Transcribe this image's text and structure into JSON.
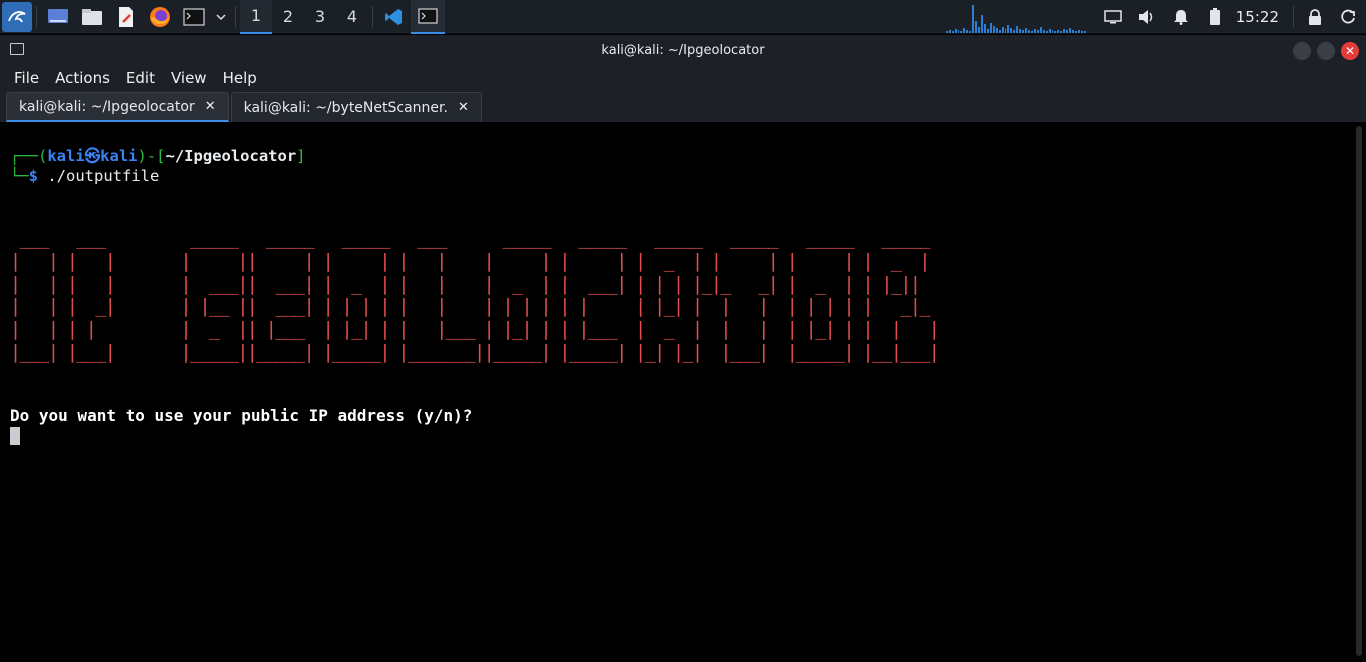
{
  "panel": {
    "workspaces": [
      "1",
      "2",
      "3",
      "4"
    ],
    "active_workspace": "1",
    "clock": "15:22",
    "launchers": [
      "kali-menu-icon",
      "desktop-icon",
      "files-icon",
      "text-editor-icon",
      "firefox-icon",
      "terminal-icon"
    ],
    "tray_icons": [
      "display-icon",
      "volume-icon",
      "bell-icon",
      "battery-icon",
      "lock-icon",
      "power-icon"
    ]
  },
  "window": {
    "title": "kali@kali: ~/Ipgeolocator"
  },
  "menu": {
    "items": [
      "File",
      "Actions",
      "Edit",
      "View",
      "Help"
    ]
  },
  "tabs": [
    {
      "label": "kali@kali: ~/Ipgeolocator",
      "active": true
    },
    {
      "label": "kali@kali: ~/byteNetScanner.",
      "active": false
    }
  ],
  "terminal": {
    "prompt_user": "kali",
    "prompt_at": "㉿",
    "prompt_host": "kali",
    "prompt_dir": "~/Ipgeolocator",
    "command": "./outputfile",
    "question": "Do you want to use your public IP address (y/n)?",
    "ascii_art": [
      " ___   ___         _____   _____   _____   ___      _____   _____   _____   _____   _____   _____",
      "|   | |   |       |     ||     | |     | |   |    |     | |     | |  _  | |     | |     | |  _  |",
      "|   | |   |       |  ___||  ___| |  _  | |   |    |  _  | |  ___| | | | |_|_   _| |  _  | | |_||",
      "|   | |  _|       | |__ ||  ___| | | | | |   |    | | | | | |     | |_| |  |   |  | | | | |   _|_",
      "|   | | |         |  _  || |___  | |_| | |   |___ | |_| | | |___  |  _  |  |   |  | |_| | |  |   |",
      "|___| |___|       |_____||_____| |_____| |_______||_____| |_____| |_| |_|  |___|  |_____| |__|___|"
    ]
  }
}
